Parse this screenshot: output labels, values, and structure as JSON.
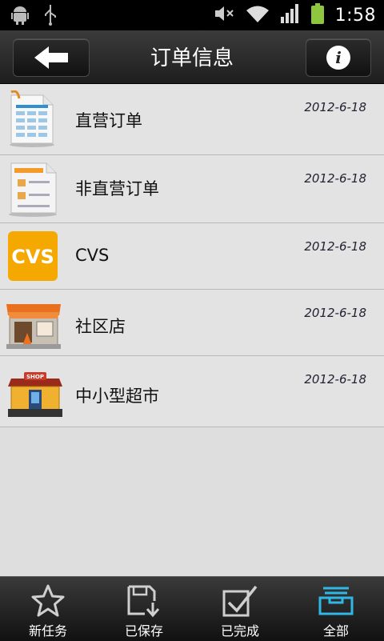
{
  "statusbar": {
    "time": "1:58"
  },
  "header": {
    "title": "订单信息"
  },
  "orders": [
    {
      "label": "直营订单",
      "date": "2012-6-18",
      "icon": "spreadsheet-document-icon"
    },
    {
      "label": "非直营订单",
      "date": "2012-6-18",
      "icon": "document-icon"
    },
    {
      "label": "CVS",
      "date": "2012-6-18",
      "icon": "cvs-logo-icon",
      "icon_text": "CVS",
      "icon_color": "#f5a800"
    },
    {
      "label": "社区店",
      "date": "2012-6-18",
      "icon": "store-icon"
    },
    {
      "label": "中小型超市",
      "date": "2012-6-18",
      "icon": "supermarket-shop-icon",
      "icon_text": "SHOP"
    }
  ],
  "tabs": [
    {
      "label": "新任务",
      "icon": "star-icon"
    },
    {
      "label": "已保存",
      "icon": "save-icon"
    },
    {
      "label": "已完成",
      "icon": "checkbox-icon"
    },
    {
      "label": "全部",
      "icon": "inbox-icon",
      "active_color": "#2fb8e6"
    }
  ]
}
